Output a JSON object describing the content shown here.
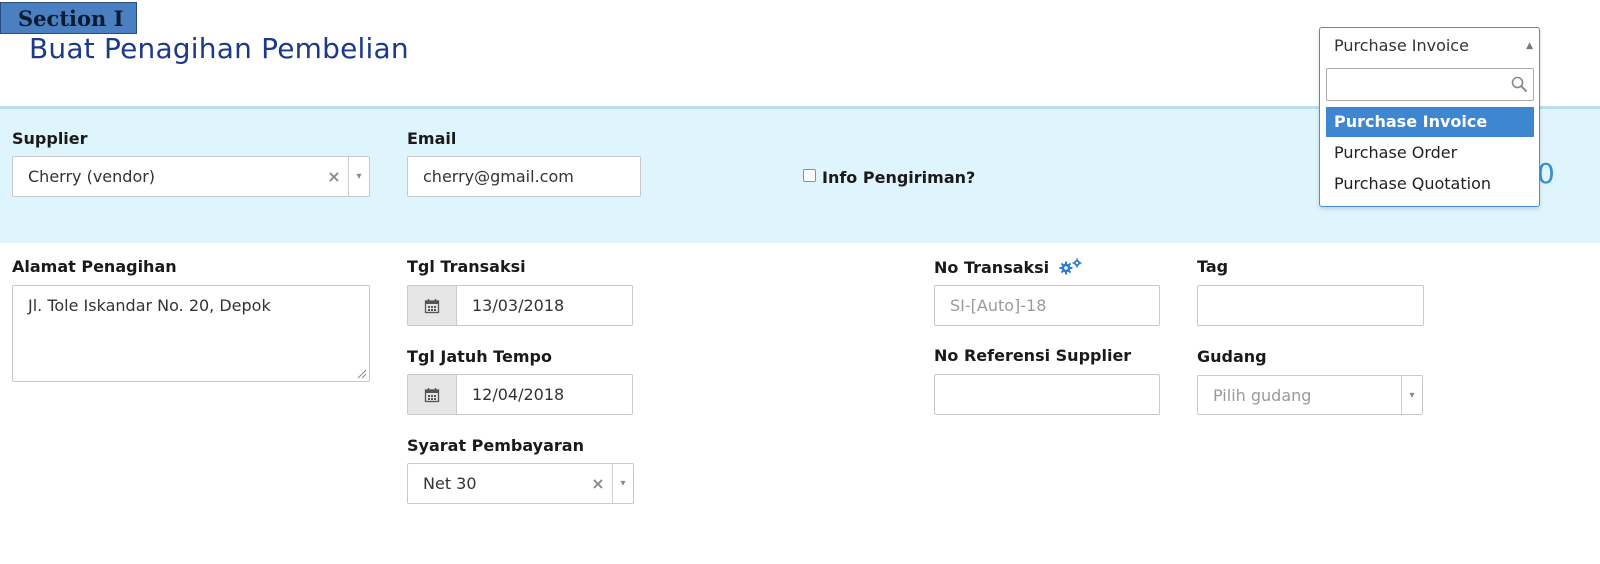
{
  "section_label": "Section I",
  "page_title": "Buat Penagihan Pembelian",
  "supplier": {
    "label": "Supplier",
    "value": "Cherry (vendor)",
    "clear_glyph": "×",
    "arrow_glyph": "▾"
  },
  "email": {
    "label": "Email",
    "value": "cherry@gmail.com"
  },
  "shipping_info": {
    "label": "Info Pengiriman?",
    "checked": false
  },
  "edge_digit": "0",
  "billing_address": {
    "label": "Alamat Penagihan",
    "value": "Jl. Tole Iskandar No. 20, Depok"
  },
  "transaction_date": {
    "label": "Tgl Transaksi",
    "value": "13/03/2018",
    "icon": "calendar-icon"
  },
  "due_date": {
    "label": "Tgl Jatuh Tempo",
    "value": "12/04/2018",
    "icon": "calendar-icon"
  },
  "payment_terms": {
    "label": "Syarat Pembayaran",
    "value": "Net 30",
    "clear_glyph": "×",
    "arrow_glyph": "▾"
  },
  "transaction_no": {
    "label": "No Transaksi",
    "placeholder": "SI-[Auto]-18",
    "icon": "gears-icon"
  },
  "supplier_reference": {
    "label": "No Referensi Supplier",
    "value": ""
  },
  "tag": {
    "label": "Tag",
    "value": ""
  },
  "warehouse": {
    "label": "Gudang",
    "placeholder": "Pilih gudang",
    "arrow_glyph": "▾"
  },
  "doc_type_dropdown": {
    "selected": "Purchase Invoice",
    "caret_glyph": "▲",
    "search_value": "",
    "search_icon": "search-icon",
    "options": [
      "Purchase Invoice",
      "Purchase Order",
      "Purchase Quotation"
    ],
    "highlighted_index": 0
  },
  "colors": {
    "title": "#1d3a8a",
    "band": "#dff5fd",
    "section_tag": "#4a7fc1",
    "accent": "#3f86d1",
    "gear": "#2f7fd0"
  }
}
